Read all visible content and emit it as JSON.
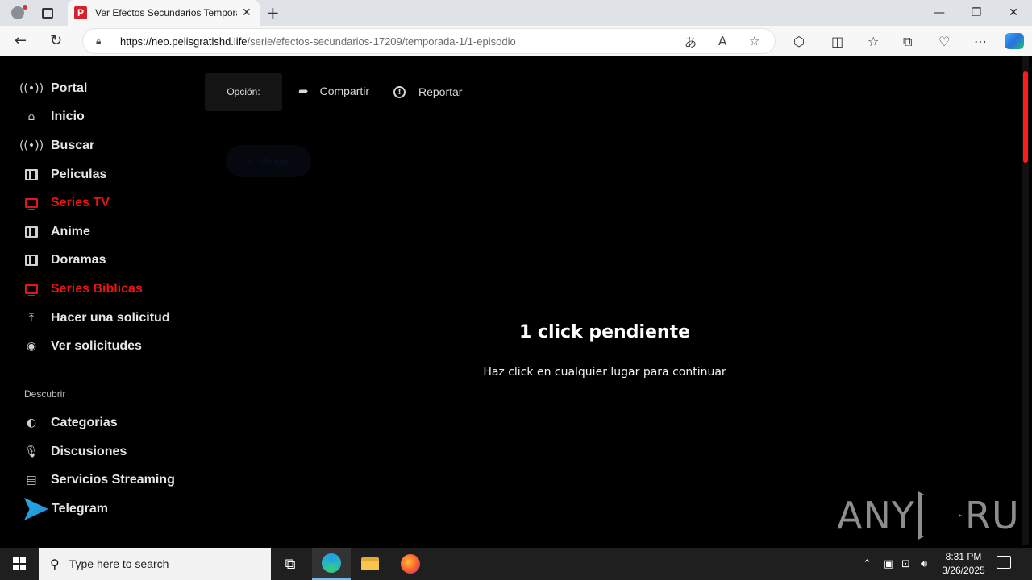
{
  "browser": {
    "tab_title": "Ver Efectos Secundarios Tempora",
    "favicon_letter": "P",
    "url_host": "https://neo.pelisgratishd.life",
    "url_path": "/serie/efectos-secundarios-17209/temporada-1/1-episodio"
  },
  "sidebar": {
    "items": [
      {
        "label": "Portal",
        "icon": "broadcast-icon"
      },
      {
        "label": "Inicio",
        "icon": "home-icon"
      },
      {
        "label": "Buscar",
        "icon": "broadcast-icon"
      },
      {
        "label": "Peliculas",
        "icon": "film-icon"
      },
      {
        "label": "Series TV",
        "icon": "tv-icon",
        "active": true
      },
      {
        "label": "Anime",
        "icon": "film-icon"
      },
      {
        "label": "Doramas",
        "icon": "film-icon"
      },
      {
        "label": "Series Biblicas",
        "icon": "tv-icon",
        "active": true
      },
      {
        "label": "Hacer una solicitud",
        "icon": "upload-icon"
      },
      {
        "label": "Ver solicitudes",
        "icon": "eye-icon"
      }
    ],
    "discover_title": "Descubrir",
    "discover": [
      {
        "label": "Categorias",
        "icon": "half-circle-icon"
      },
      {
        "label": "Discusiones",
        "icon": "microphone-icon"
      },
      {
        "label": "Servicios Streaming",
        "icon": "streaming-icon"
      },
      {
        "label": "Telegram",
        "icon": "telegram-icon"
      }
    ]
  },
  "toolbar": {
    "option_label": "Opción:",
    "share_label": "Compartir",
    "report_label": "Reportar",
    "back_label": "Volver"
  },
  "overlay": {
    "title": "1 click pendiente",
    "subtitle": "Haz click en cualquier lugar para continuar"
  },
  "watermark": {
    "left": "ANY",
    "right": "RUN"
  },
  "taskbar": {
    "search_placeholder": "Type here to search",
    "time": "8:31 PM",
    "date": "3/26/2025"
  },
  "colors": {
    "accent_red": "#e81414",
    "page_bg": "#000000"
  }
}
